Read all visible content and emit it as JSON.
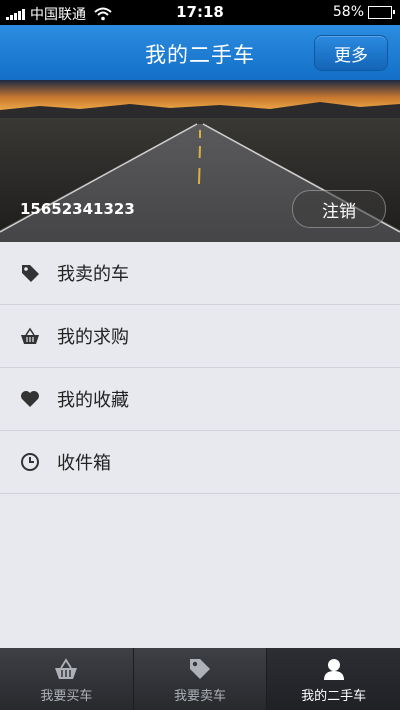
{
  "status_bar": {
    "carrier": "中国联通",
    "time": "17:18",
    "battery": "58%",
    "battery_level": 0.58
  },
  "nav": {
    "title": "我的二手车",
    "more_label": "更多"
  },
  "profile": {
    "phone": "15652341323",
    "logout_label": "注销"
  },
  "menu": [
    {
      "label": "我卖的车",
      "icon": "tag-icon"
    },
    {
      "label": "我的求购",
      "icon": "basket-icon"
    },
    {
      "label": "我的收藏",
      "icon": "heart-icon"
    },
    {
      "label": "收件箱",
      "icon": "clock-icon"
    }
  ],
  "tabs": [
    {
      "label": "我要买车",
      "icon": "basket-icon",
      "active": false
    },
    {
      "label": "我要卖车",
      "icon": "tag-icon",
      "active": false
    },
    {
      "label": "我的二手车",
      "icon": "user-icon",
      "active": true
    }
  ]
}
